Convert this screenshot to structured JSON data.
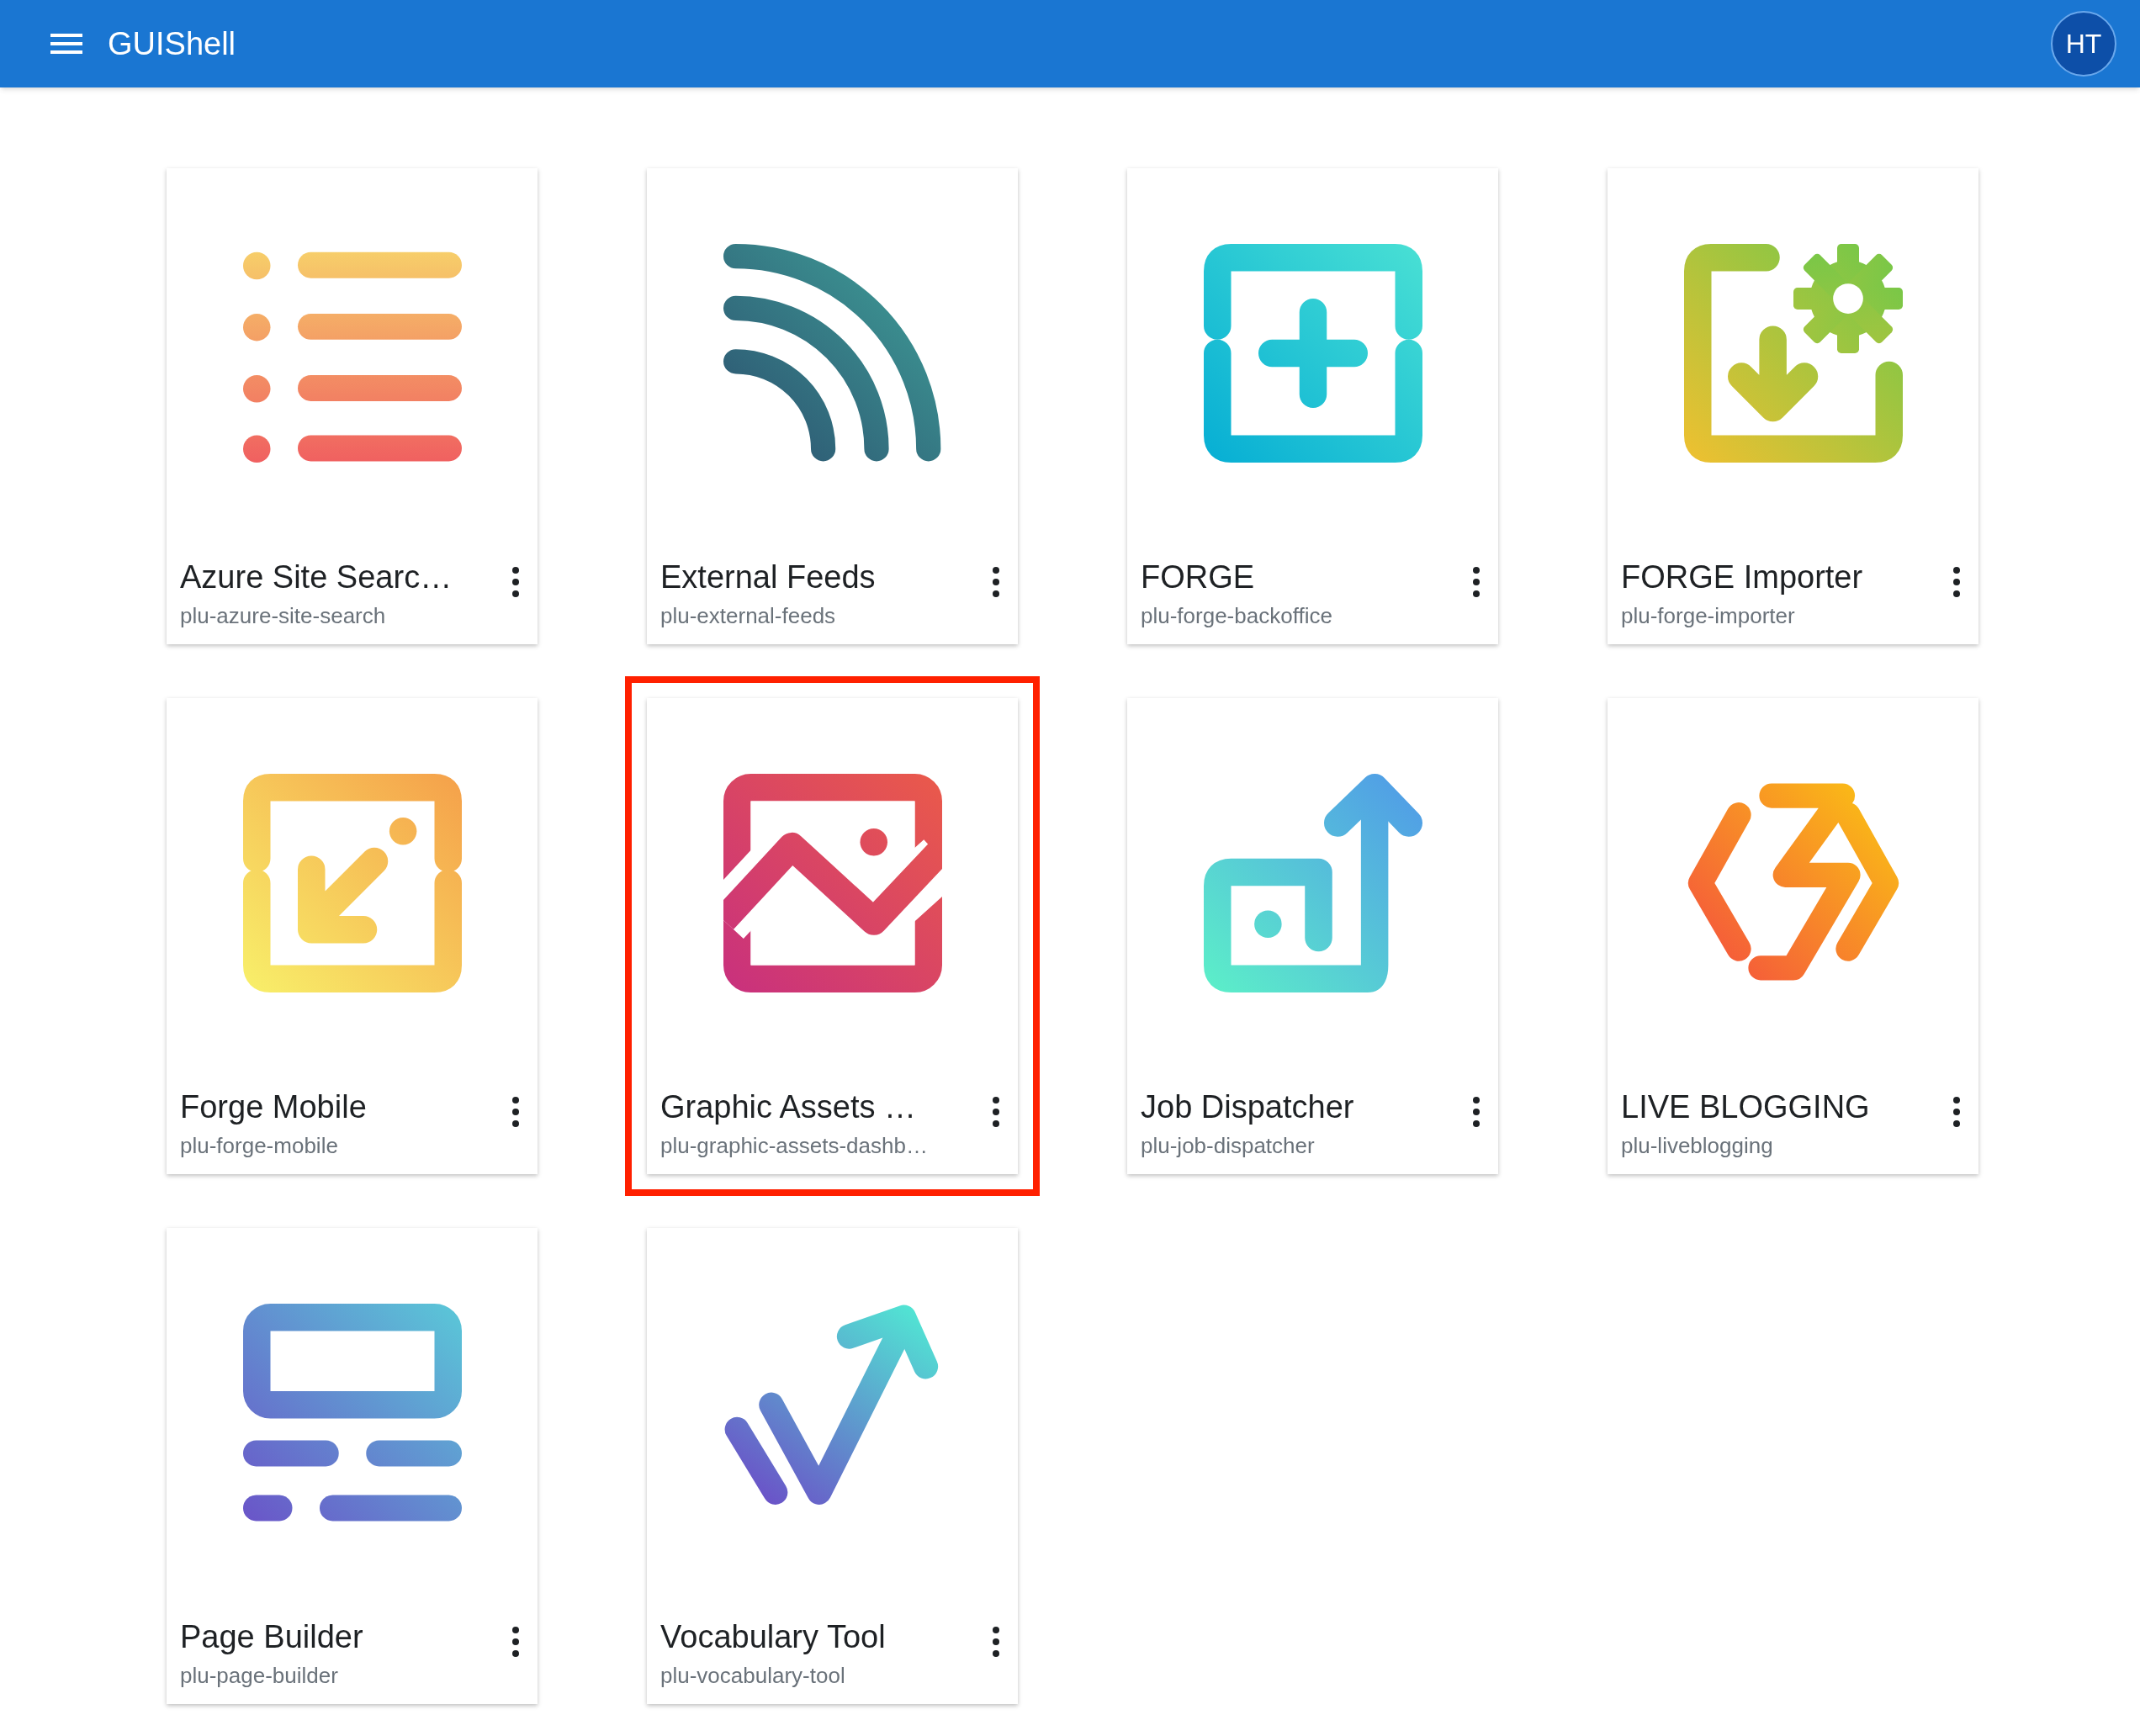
{
  "app_bar": {
    "title": "GUIShell",
    "avatar": "HT"
  },
  "cards": [
    {
      "title": "Azure Site Searc…",
      "subtitle": "plu-azure-site-search",
      "selected": false
    },
    {
      "title": "External Feeds",
      "subtitle": "plu-external-feeds",
      "selected": false
    },
    {
      "title": "FORGE",
      "subtitle": "plu-forge-backoffice",
      "selected": false
    },
    {
      "title": "FORGE Importer",
      "subtitle": "plu-forge-importer",
      "selected": false
    },
    {
      "title": "Forge Mobile",
      "subtitle": "plu-forge-mobile",
      "selected": false
    },
    {
      "title": "Graphic Assets …",
      "subtitle": "plu-graphic-assets-dashb…",
      "selected": true
    },
    {
      "title": "Job Dispatcher",
      "subtitle": "plu-job-dispatcher",
      "selected": false
    },
    {
      "title": "LIVE BLOGGING",
      "subtitle": "plu-liveblogging",
      "selected": false
    },
    {
      "title": "Page Builder",
      "subtitle": "plu-page-builder",
      "selected": false
    },
    {
      "title": "Vocabulary Tool",
      "subtitle": "plu-vocabulary-tool",
      "selected": false
    }
  ]
}
